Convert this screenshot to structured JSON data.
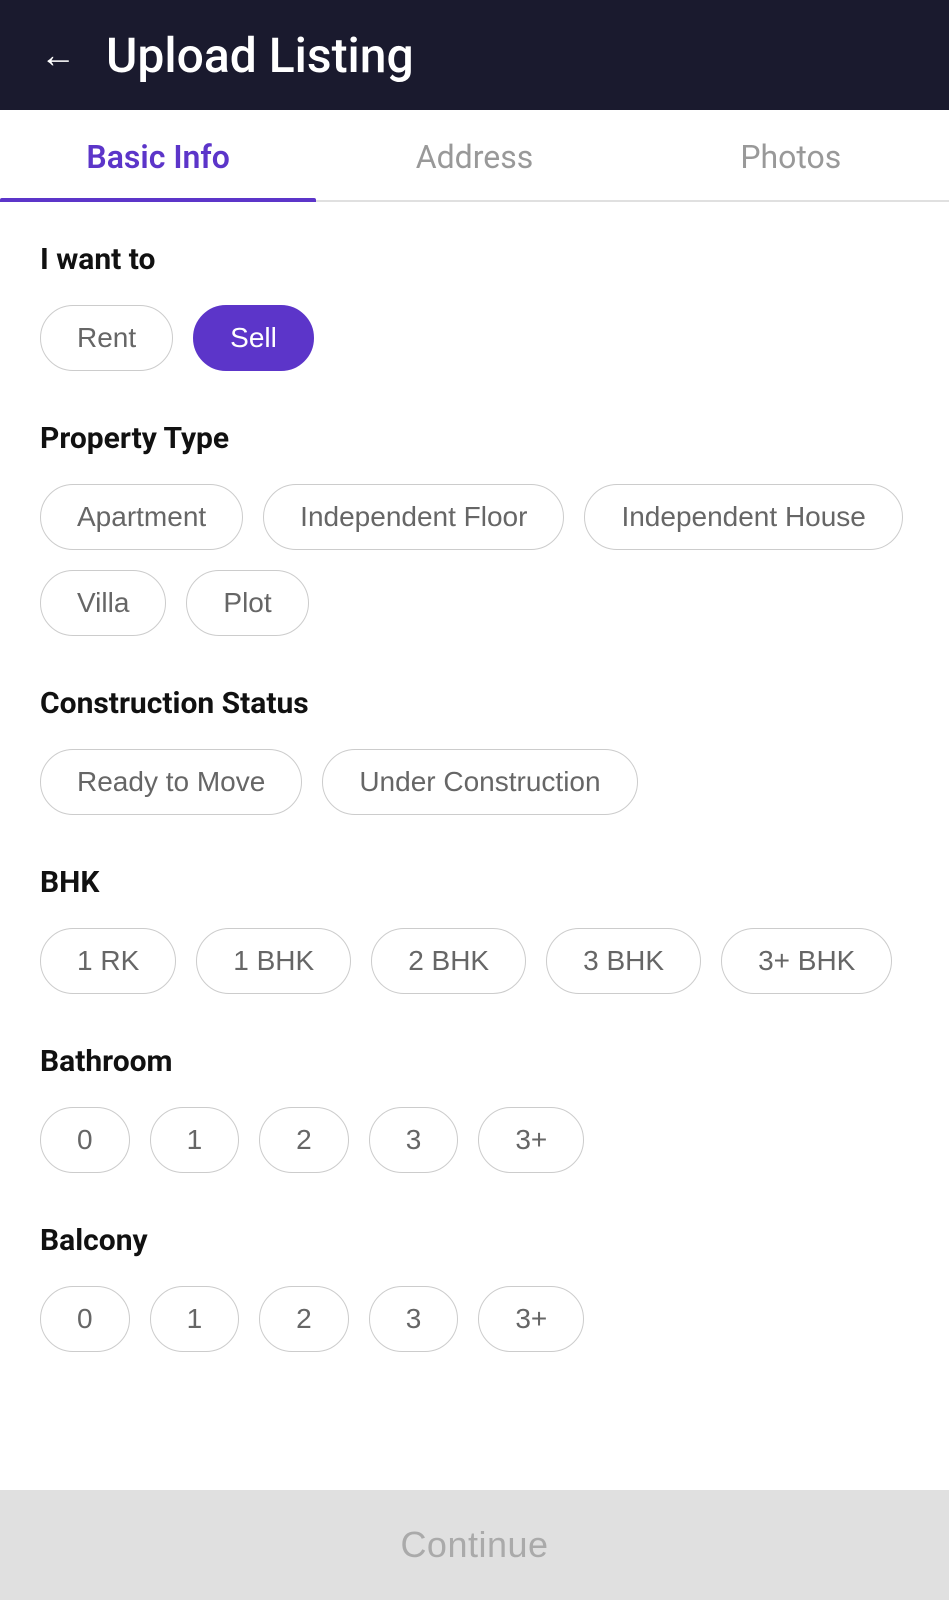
{
  "header": {
    "back_icon": "←",
    "title": "Upload Listing"
  },
  "tabs": [
    {
      "id": "basic-info",
      "label": "Basic Info",
      "active": true
    },
    {
      "id": "address",
      "label": "Address",
      "active": false
    },
    {
      "id": "photos",
      "label": "Photos",
      "active": false
    }
  ],
  "sections": {
    "i_want_to": {
      "label": "I want to",
      "options": [
        {
          "id": "rent",
          "label": "Rent",
          "selected": false
        },
        {
          "id": "sell",
          "label": "Sell",
          "selected": true
        }
      ]
    },
    "property_type": {
      "label": "Property Type",
      "options": [
        {
          "id": "apartment",
          "label": "Apartment",
          "selected": false
        },
        {
          "id": "independent-floor",
          "label": "Independent Floor",
          "selected": false
        },
        {
          "id": "independent-house",
          "label": "Independent House",
          "selected": false
        },
        {
          "id": "villa",
          "label": "Villa",
          "selected": false
        },
        {
          "id": "plot",
          "label": "Plot",
          "selected": false
        }
      ]
    },
    "construction_status": {
      "label": "Construction Status",
      "options": [
        {
          "id": "ready-to-move",
          "label": "Ready to Move",
          "selected": false
        },
        {
          "id": "under-construction",
          "label": "Under Construction",
          "selected": false
        }
      ]
    },
    "bhk": {
      "label": "BHK",
      "options": [
        {
          "id": "1rk",
          "label": "1 RK",
          "selected": false
        },
        {
          "id": "1bhk",
          "label": "1 BHK",
          "selected": false
        },
        {
          "id": "2bhk",
          "label": "2 BHK",
          "selected": false
        },
        {
          "id": "3bhk",
          "label": "3 BHK",
          "selected": false
        },
        {
          "id": "3plus-bhk",
          "label": "3+ BHK",
          "selected": false
        }
      ]
    },
    "bathroom": {
      "label": "Bathroom",
      "options": [
        {
          "id": "bath-0",
          "label": "0",
          "selected": false
        },
        {
          "id": "bath-1",
          "label": "1",
          "selected": false
        },
        {
          "id": "bath-2",
          "label": "2",
          "selected": false
        },
        {
          "id": "bath-3",
          "label": "3",
          "selected": false
        },
        {
          "id": "bath-3plus",
          "label": "3+",
          "selected": false
        }
      ]
    },
    "balcony": {
      "label": "Balcony",
      "options": [
        {
          "id": "bal-0",
          "label": "0",
          "selected": false
        },
        {
          "id": "bal-1",
          "label": "1",
          "selected": false
        },
        {
          "id": "bal-2",
          "label": "2",
          "selected": false
        },
        {
          "id": "bal-3",
          "label": "3",
          "selected": false
        },
        {
          "id": "bal-3plus",
          "label": "3+",
          "selected": false
        }
      ]
    }
  },
  "continue_button": {
    "label": "Continue"
  }
}
